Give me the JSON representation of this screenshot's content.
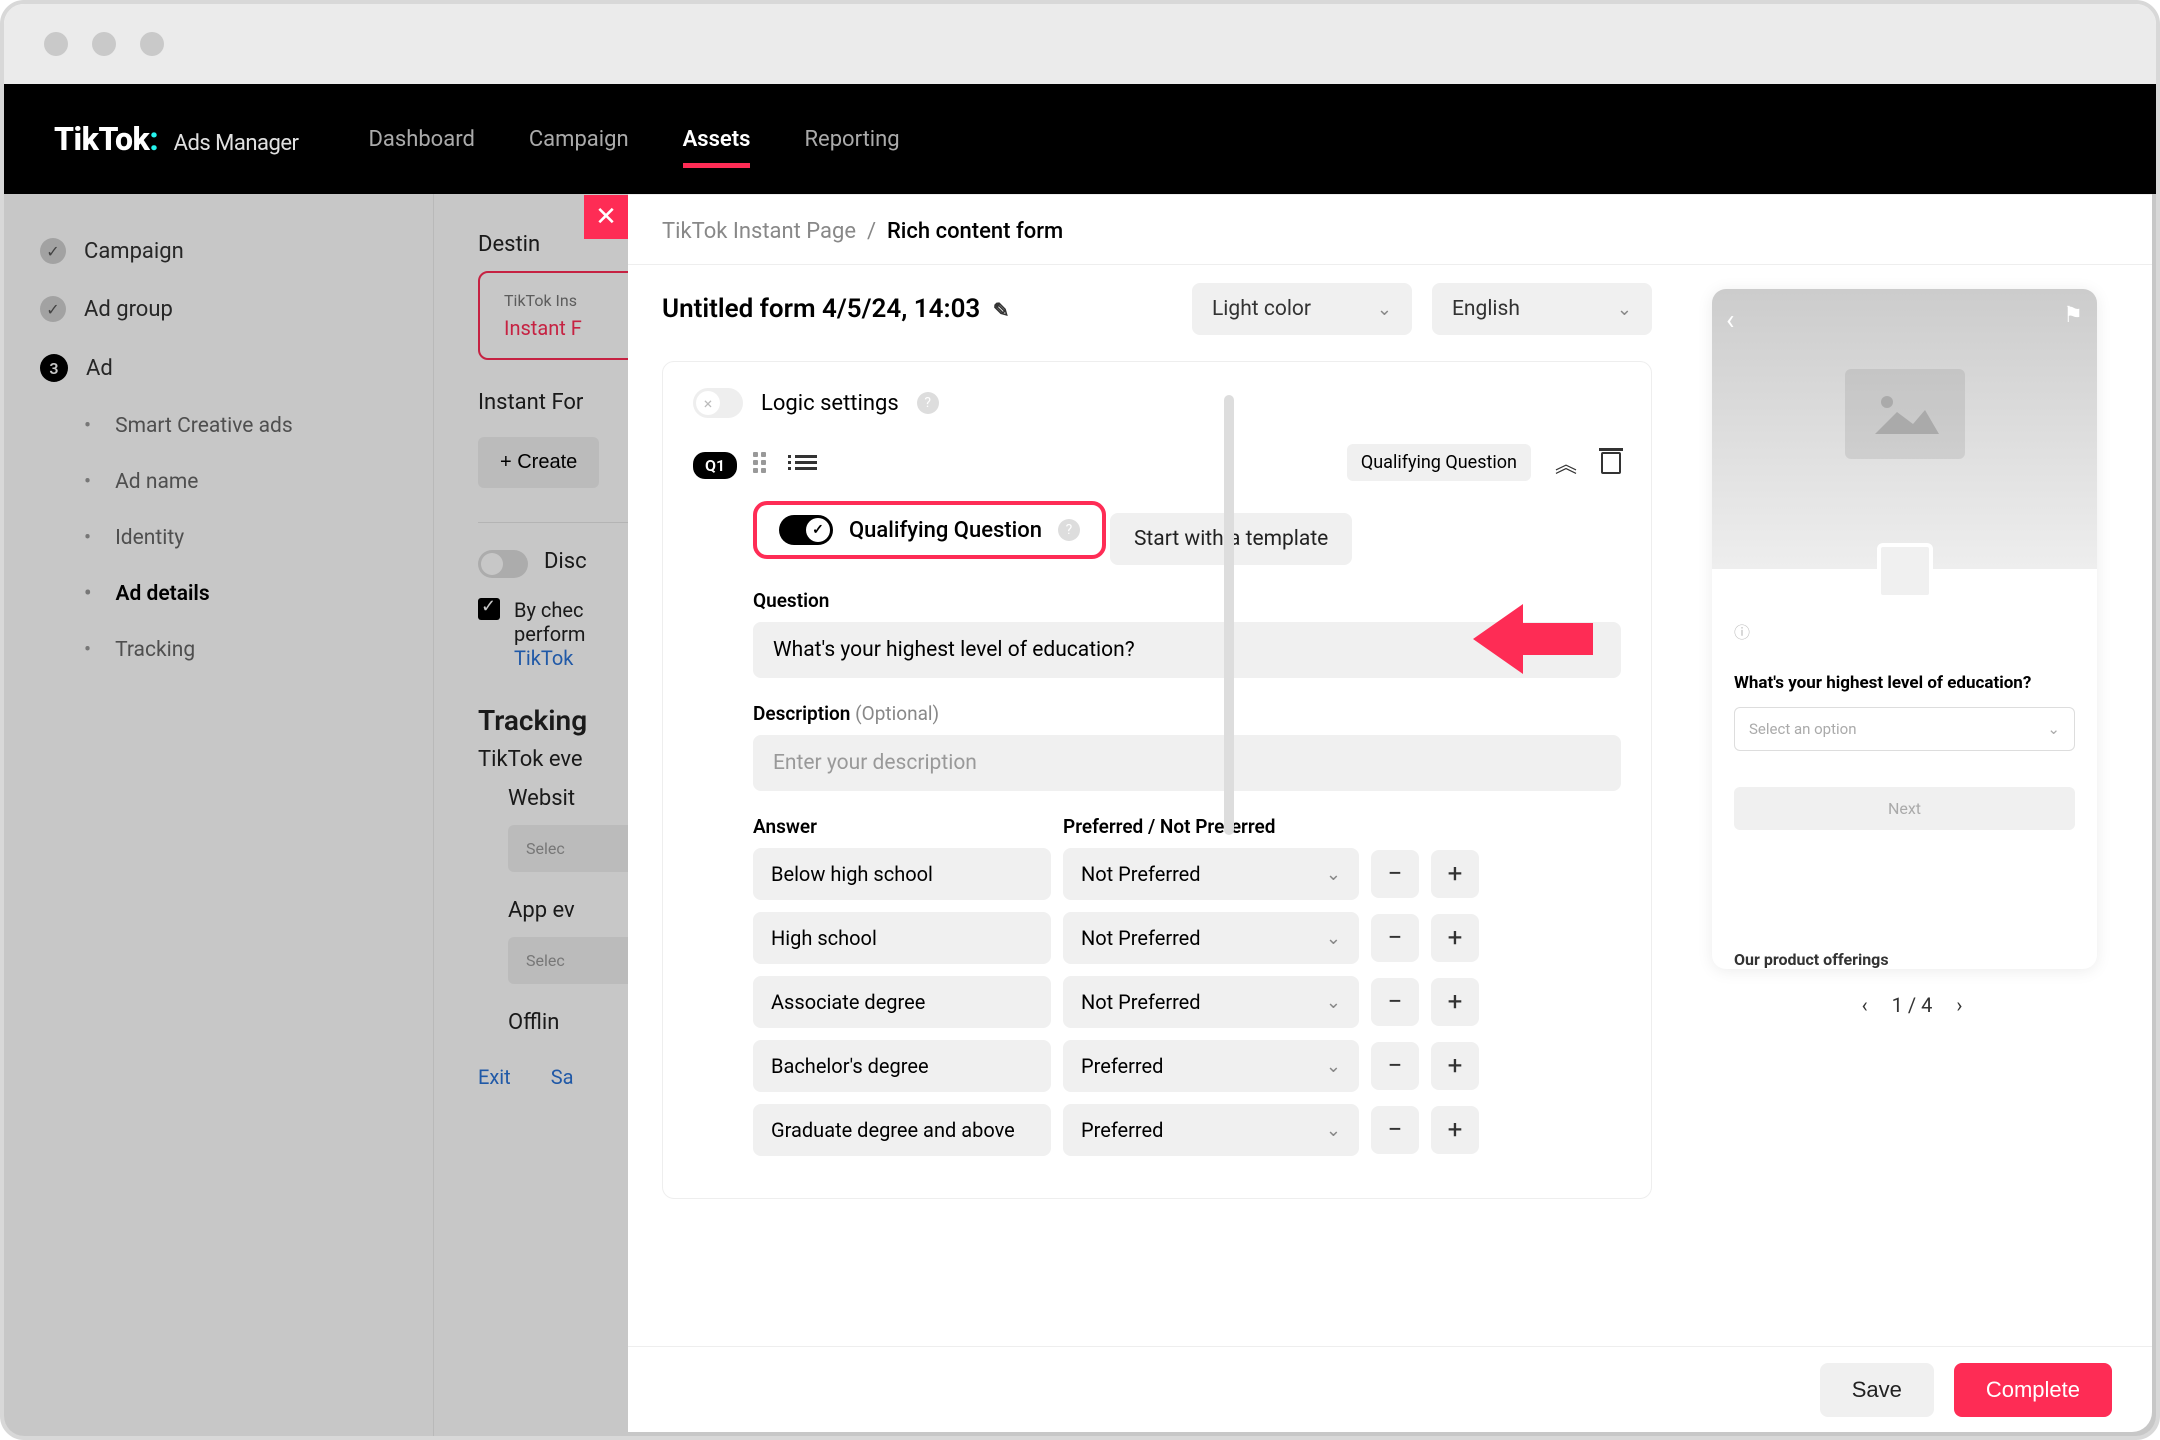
{
  "brand": {
    "name": "TikTok",
    "sub": "Ads Manager"
  },
  "nav": {
    "dashboard": "Dashboard",
    "campaign": "Campaign",
    "assets": "Assets",
    "reporting": "Reporting"
  },
  "sidebar": {
    "campaign": "Campaign",
    "adgroup": "Ad group",
    "ad": "Ad",
    "ad_num": "3",
    "subs": {
      "smart": "Smart Creative ads",
      "adname": "Ad name",
      "identity": "Identity",
      "addetails": "Ad details",
      "tracking": "Tracking"
    }
  },
  "base": {
    "dest": "Destin",
    "card_sm": "TikTok Ins",
    "card_lg": "Instant F",
    "instant_form": "Instant For",
    "create": "+ Create",
    "disc": "Disc",
    "check_txt": "By chec",
    "check_txt2": "perform",
    "check_link": "TikTok",
    "tracking_head": "Tracking",
    "tiktok_ev": "TikTok eve",
    "websit": "Websit",
    "appev": "App ev",
    "selec": "Selec",
    "offlin": "Offlin",
    "exit": "Exit",
    "save": "Sa"
  },
  "panel": {
    "crumb1": "TikTok Instant Page",
    "crumb2": "Rich content form",
    "title": "Untitled form 4/5/24, 14:03",
    "theme": "Light color",
    "lang": "English"
  },
  "editor": {
    "logic": "Logic settings",
    "q1": "Q1",
    "tag": "Qualifying Question",
    "qq": "Qualifying Question",
    "template_btn": "Start with a template",
    "question_label": "Question",
    "question_val": "What's your highest level of education?",
    "desc_label": "Description",
    "desc_opt": "(Optional)",
    "desc_ph": "Enter your description",
    "answer_label": "Answer",
    "pref_label": "Preferred / Not Preferred",
    "answers": [
      {
        "text": "Below high school",
        "pref": "Not Preferred"
      },
      {
        "text": "High school",
        "pref": "Not Preferred"
      },
      {
        "text": "Associate degree",
        "pref": "Not Preferred"
      },
      {
        "text": "Bachelor's degree",
        "pref": "Preferred"
      },
      {
        "text": "Graduate degree and above",
        "pref": "Preferred"
      }
    ]
  },
  "preview": {
    "question": "What's your highest level of education?",
    "select_ph": "Select an option",
    "next": "Next",
    "footer": "Our product offerings",
    "page": "1 / 4"
  },
  "footer": {
    "save": "Save",
    "complete": "Complete"
  }
}
